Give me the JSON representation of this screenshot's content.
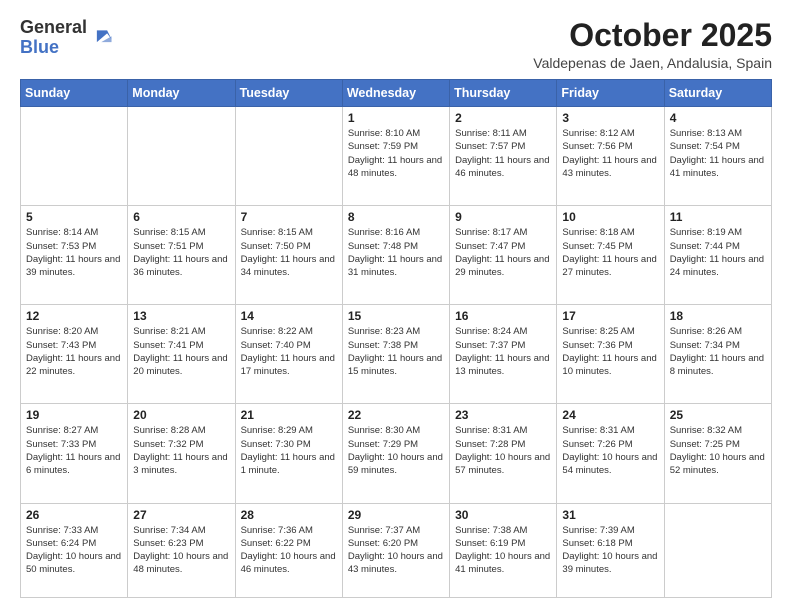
{
  "logo": {
    "general": "General",
    "blue": "Blue"
  },
  "header": {
    "month": "October 2025",
    "location": "Valdepenas de Jaen, Andalusia, Spain"
  },
  "weekdays": [
    "Sunday",
    "Monday",
    "Tuesday",
    "Wednesday",
    "Thursday",
    "Friday",
    "Saturday"
  ],
  "weeks": [
    [
      {
        "day": "",
        "info": ""
      },
      {
        "day": "",
        "info": ""
      },
      {
        "day": "",
        "info": ""
      },
      {
        "day": "1",
        "info": "Sunrise: 8:10 AM\nSunset: 7:59 PM\nDaylight: 11 hours and 48 minutes."
      },
      {
        "day": "2",
        "info": "Sunrise: 8:11 AM\nSunset: 7:57 PM\nDaylight: 11 hours and 46 minutes."
      },
      {
        "day": "3",
        "info": "Sunrise: 8:12 AM\nSunset: 7:56 PM\nDaylight: 11 hours and 43 minutes."
      },
      {
        "day": "4",
        "info": "Sunrise: 8:13 AM\nSunset: 7:54 PM\nDaylight: 11 hours and 41 minutes."
      }
    ],
    [
      {
        "day": "5",
        "info": "Sunrise: 8:14 AM\nSunset: 7:53 PM\nDaylight: 11 hours and 39 minutes."
      },
      {
        "day": "6",
        "info": "Sunrise: 8:15 AM\nSunset: 7:51 PM\nDaylight: 11 hours and 36 minutes."
      },
      {
        "day": "7",
        "info": "Sunrise: 8:15 AM\nSunset: 7:50 PM\nDaylight: 11 hours and 34 minutes."
      },
      {
        "day": "8",
        "info": "Sunrise: 8:16 AM\nSunset: 7:48 PM\nDaylight: 11 hours and 31 minutes."
      },
      {
        "day": "9",
        "info": "Sunrise: 8:17 AM\nSunset: 7:47 PM\nDaylight: 11 hours and 29 minutes."
      },
      {
        "day": "10",
        "info": "Sunrise: 8:18 AM\nSunset: 7:45 PM\nDaylight: 11 hours and 27 minutes."
      },
      {
        "day": "11",
        "info": "Sunrise: 8:19 AM\nSunset: 7:44 PM\nDaylight: 11 hours and 24 minutes."
      }
    ],
    [
      {
        "day": "12",
        "info": "Sunrise: 8:20 AM\nSunset: 7:43 PM\nDaylight: 11 hours and 22 minutes."
      },
      {
        "day": "13",
        "info": "Sunrise: 8:21 AM\nSunset: 7:41 PM\nDaylight: 11 hours and 20 minutes."
      },
      {
        "day": "14",
        "info": "Sunrise: 8:22 AM\nSunset: 7:40 PM\nDaylight: 11 hours and 17 minutes."
      },
      {
        "day": "15",
        "info": "Sunrise: 8:23 AM\nSunset: 7:38 PM\nDaylight: 11 hours and 15 minutes."
      },
      {
        "day": "16",
        "info": "Sunrise: 8:24 AM\nSunset: 7:37 PM\nDaylight: 11 hours and 13 minutes."
      },
      {
        "day": "17",
        "info": "Sunrise: 8:25 AM\nSunset: 7:36 PM\nDaylight: 11 hours and 10 minutes."
      },
      {
        "day": "18",
        "info": "Sunrise: 8:26 AM\nSunset: 7:34 PM\nDaylight: 11 hours and 8 minutes."
      }
    ],
    [
      {
        "day": "19",
        "info": "Sunrise: 8:27 AM\nSunset: 7:33 PM\nDaylight: 11 hours and 6 minutes."
      },
      {
        "day": "20",
        "info": "Sunrise: 8:28 AM\nSunset: 7:32 PM\nDaylight: 11 hours and 3 minutes."
      },
      {
        "day": "21",
        "info": "Sunrise: 8:29 AM\nSunset: 7:30 PM\nDaylight: 11 hours and 1 minute."
      },
      {
        "day": "22",
        "info": "Sunrise: 8:30 AM\nSunset: 7:29 PM\nDaylight: 10 hours and 59 minutes."
      },
      {
        "day": "23",
        "info": "Sunrise: 8:31 AM\nSunset: 7:28 PM\nDaylight: 10 hours and 57 minutes."
      },
      {
        "day": "24",
        "info": "Sunrise: 8:31 AM\nSunset: 7:26 PM\nDaylight: 10 hours and 54 minutes."
      },
      {
        "day": "25",
        "info": "Sunrise: 8:32 AM\nSunset: 7:25 PM\nDaylight: 10 hours and 52 minutes."
      }
    ],
    [
      {
        "day": "26",
        "info": "Sunrise: 7:33 AM\nSunset: 6:24 PM\nDaylight: 10 hours and 50 minutes."
      },
      {
        "day": "27",
        "info": "Sunrise: 7:34 AM\nSunset: 6:23 PM\nDaylight: 10 hours and 48 minutes."
      },
      {
        "day": "28",
        "info": "Sunrise: 7:36 AM\nSunset: 6:22 PM\nDaylight: 10 hours and 46 minutes."
      },
      {
        "day": "29",
        "info": "Sunrise: 7:37 AM\nSunset: 6:20 PM\nDaylight: 10 hours and 43 minutes."
      },
      {
        "day": "30",
        "info": "Sunrise: 7:38 AM\nSunset: 6:19 PM\nDaylight: 10 hours and 41 minutes."
      },
      {
        "day": "31",
        "info": "Sunrise: 7:39 AM\nSunset: 6:18 PM\nDaylight: 10 hours and 39 minutes."
      },
      {
        "day": "",
        "info": ""
      }
    ]
  ]
}
